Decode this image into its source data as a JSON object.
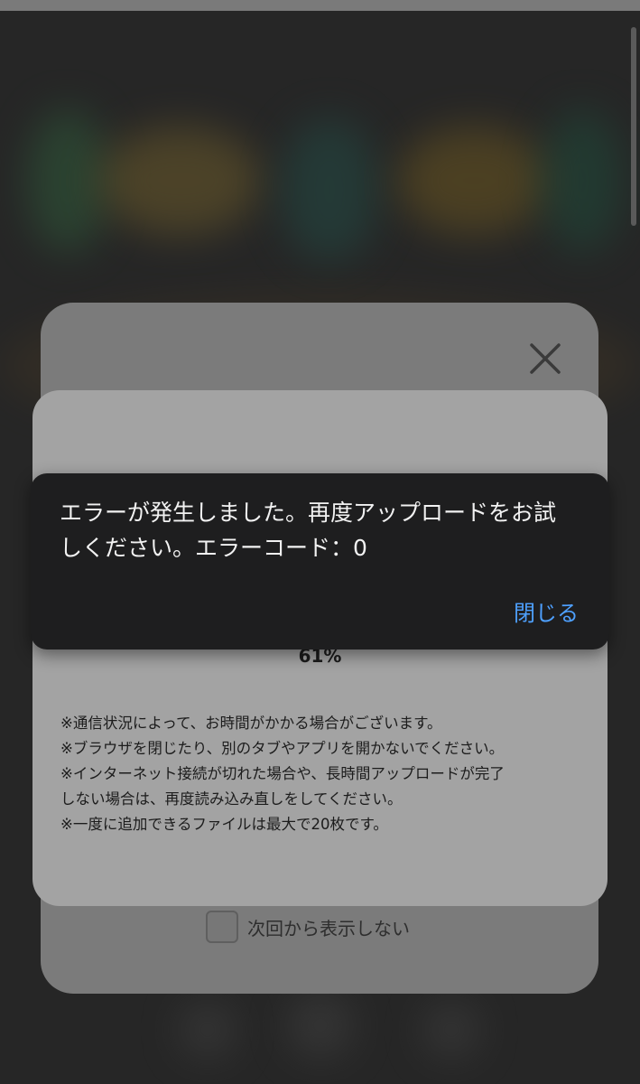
{
  "error_snackbar": {
    "message": "エラーが発生しました。再度アップロードをお試しください。エラーコード：0",
    "close_label": "閉じる"
  },
  "upload_dialog": {
    "progress_text": "61%",
    "notes": [
      "※通信状況によって、お時間がかかる場合がございます。",
      "※ブラウザを閉じたり、別のタブやアプリを開かないでください。",
      "※インターネット接続が切れた場合や、長時間アップロードが完了",
      "しない場合は、再度読み込み直しをしてください。",
      "※一度に追加できるファイルは最大で20枚です。"
    ]
  },
  "back_modal": {
    "dont_show_again_label": "次回から表示しない",
    "dont_show_again_checked": false,
    "close_icon": "close-icon"
  },
  "colors": {
    "snackbar_background": "#1e1e1f",
    "snackbar_action": "#4ea0ff",
    "panel_background": "#a3a3a3",
    "back_modal_background": "#7b7b7b"
  }
}
